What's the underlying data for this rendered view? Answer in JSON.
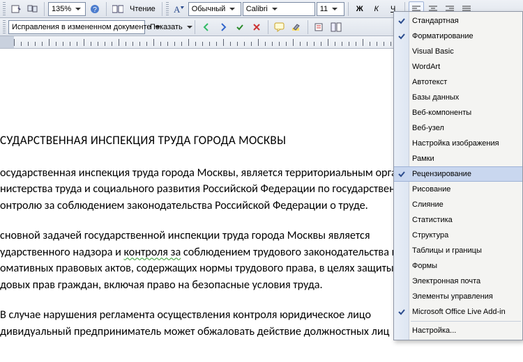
{
  "toolbar1": {
    "zoom": "135%",
    "reading": "Чтение",
    "style": "Обычный",
    "font": "Calibri",
    "size": "11",
    "bold": "Ж",
    "italic": "К",
    "underline": "Ч"
  },
  "toolbar2": {
    "tracking": "Исправления в измененном документе",
    "show": "Показать"
  },
  "menu": {
    "items": [
      {
        "label": "Стандартная",
        "checked": true
      },
      {
        "label": "Форматирование",
        "checked": true
      },
      {
        "label": "Visual Basic"
      },
      {
        "label": "WordArt"
      },
      {
        "label": "Автотекст"
      },
      {
        "label": "Базы данных"
      },
      {
        "label": "Веб-компоненты"
      },
      {
        "label": "Веб-узел"
      },
      {
        "label": "Настройка изображения"
      },
      {
        "label": "Рамки"
      },
      {
        "label": "Рецензирование",
        "checked": true,
        "highlight": true
      },
      {
        "label": "Рисование"
      },
      {
        "label": "Слияние"
      },
      {
        "label": "Статистика"
      },
      {
        "label": "Структура"
      },
      {
        "label": "Таблицы и границы"
      },
      {
        "label": "Формы"
      },
      {
        "label": "Электронная почта"
      },
      {
        "label": "Элементы управления"
      },
      {
        "label": "Microsoft Office Live Add-in",
        "checked": true
      }
    ],
    "customize": "Настройка..."
  },
  "document": {
    "title": "СУДАРСТВЕННАЯ ИНСПЕКЦИЯ ТРУДА ГОРОДА МОСКВЫ",
    "p1a": "осударственная инспекция труда города Москвы, является территориальным органом",
    "p1b": "нистерства труда и социального развития Российской Федерации по государственному",
    "p1c": "онтролю за соблюдением законодательства Российской Федерации о труде.",
    "p2a": "сновной задачей государственной инспекции труда города Москвы является",
    "p2b_pre": "ударственного надзора и ",
    "p2b_wavy": "контроля за",
    "p2b_post": " соблюдением трудового законодательства и",
    "p2c": "омативных правовых актов, содержащих нормы трудового права, в целях защиты",
    "p2d": "довых прав граждан, включая право на безопасные условия труда.",
    "p3a": "В случае нарушения регламента осуществления контроля юридическое лицо",
    "p3b": "дивидуальный предприниматель может обжаловать действие должностных лиц"
  }
}
